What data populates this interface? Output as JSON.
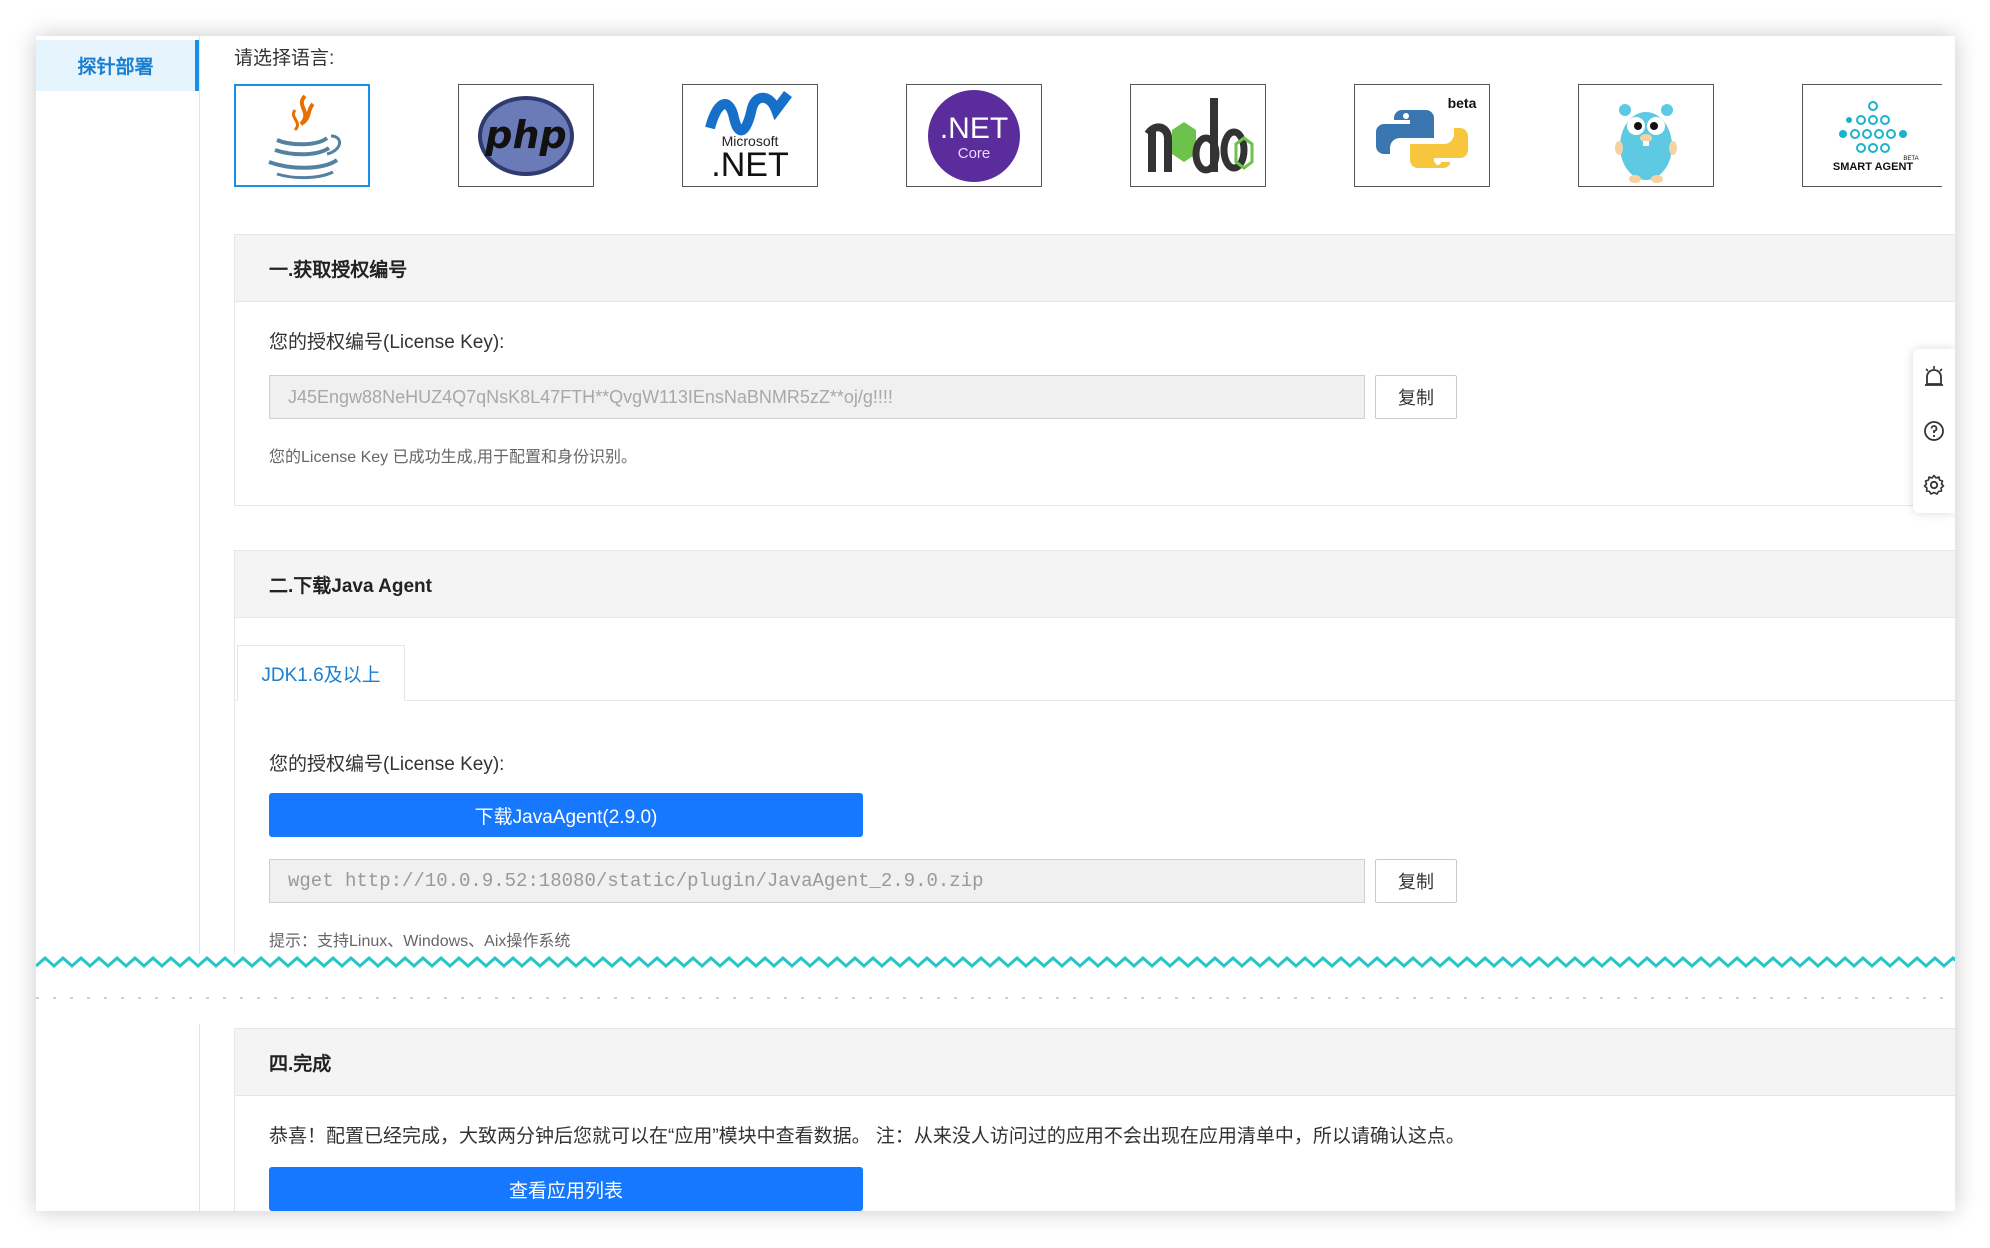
{
  "sidebar": {
    "active_item": "探针部署"
  },
  "language_select": {
    "label": "请选择语言:",
    "options": [
      {
        "name": "java-icon",
        "selected": true
      },
      {
        "name": "php-icon",
        "text": "php"
      },
      {
        "name": "dotnet-icon",
        "text_top": "Microsoft",
        "text_bottom": ".NET"
      },
      {
        "name": "dotnet-core-icon",
        "text_top": ".NET",
        "text_bottom": "Core"
      },
      {
        "name": "nodejs-icon",
        "text": "node"
      },
      {
        "name": "python-icon",
        "badge": "beta"
      },
      {
        "name": "go-gopher-icon"
      },
      {
        "name": "smart-agent-icon",
        "text": "SMART AGENT",
        "badge": "BETA"
      }
    ]
  },
  "step1": {
    "title": "一.获取授权编号",
    "field_label": "您的授权编号(License Key):",
    "license_key": "J45Engw88NeHUZ4Q7qNsK8L47FTH**QvgW113IEnsNaBNMR5zZ**oj/g!!!!",
    "copy_label": "复制",
    "hint": "您的License Key 已成功生成,用于配置和身份识别。"
  },
  "step2": {
    "title": "二.下载Java Agent",
    "tab_label": "JDK1.6及以上",
    "field_label": "您的授权编号(License Key):",
    "download_label": "下载JavaAgent(2.9.0)",
    "wget_command": "wget http://10.0.9.52:18080/static/plugin/JavaAgent_2.9.0.zip",
    "copy_label": "复制",
    "hint": "提示：支持Linux、Windows、Aix操作系统"
  },
  "step4": {
    "title": "四.完成",
    "message": "恭喜！配置已经完成，大致两分钟后您就可以在“应用”模块中查看数据。 注：从来没人访问过的应用不会出现在应用清单中，所以请确认这点。",
    "button_label": "查看应用列表"
  },
  "floating_toolbar": {
    "icons": [
      "alarm-icon",
      "help-icon",
      "settings-icon"
    ]
  },
  "colors": {
    "primary": "#1677ff",
    "accent": "#1a8fe6",
    "tear_line": "#26c6c6"
  }
}
